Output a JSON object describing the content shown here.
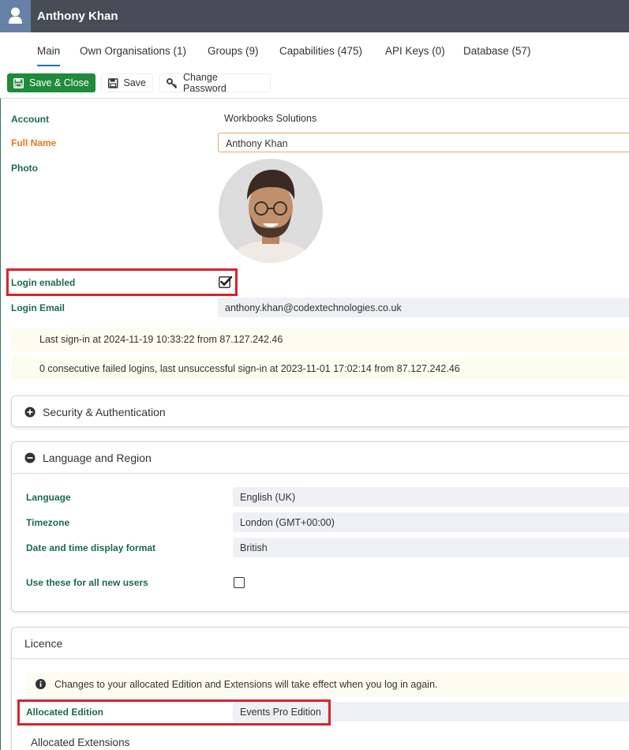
{
  "header": {
    "title": "Anthony Khan"
  },
  "tabs": [
    {
      "label": "Main",
      "active": true
    },
    {
      "label": "Own Organisations (1)"
    },
    {
      "label": "Groups (9)"
    },
    {
      "label": "Capabilities (475)"
    },
    {
      "label": "API Keys (0)"
    },
    {
      "label": "Database (57)"
    }
  ],
  "toolbar": {
    "save_close_label": "Save & Close",
    "save_label": "Save",
    "change_password_label": "Change Password"
  },
  "form": {
    "account": {
      "label": "Account",
      "value": "Workbooks Solutions"
    },
    "full_name": {
      "label": "Full Name",
      "value": "Anthony Khan"
    },
    "photo": {
      "label": "Photo"
    },
    "login_enabled": {
      "label": "Login enabled",
      "checked": true
    },
    "login_email": {
      "label": "Login Email",
      "value": "anthony.khan@codextechnologies.co.uk"
    },
    "last_signin": "Last sign-in at 2024-11-19 10:33:22 from 87.127.242.46",
    "failed_logins": "0 consecutive failed logins, last unsuccessful sign-in at 2023-11-01 17:02:14 from 87.127.242.46"
  },
  "security_panel": {
    "title": "Security & Authentication",
    "icon": "plus-circle-icon"
  },
  "language_panel": {
    "title": "Language and Region",
    "icon": "minus-circle-icon",
    "language": {
      "label": "Language",
      "value": "English (UK)"
    },
    "timezone": {
      "label": "Timezone",
      "value": "London (GMT+00:00)"
    },
    "date_format": {
      "label": "Date and time display format",
      "value": "British"
    },
    "use_for_new_users": {
      "label": "Use these for all new users",
      "checked": false
    }
  },
  "licence_panel": {
    "title": "Licence",
    "info": "Changes to your allocated Edition and Extensions will take effect when you log in again.",
    "allocated_edition": {
      "label": "Allocated Edition",
      "value": "Events Pro Edition"
    },
    "allocated_extensions_label": "Allocated Extensions"
  },
  "colors": {
    "header_bg": "#474c56",
    "avatar_bg": "#6781a6",
    "label_green": "#1d6a48",
    "label_orange": "#e27a1c",
    "primary_button": "#1f8b3a",
    "highlight_red": "#d8232a"
  }
}
